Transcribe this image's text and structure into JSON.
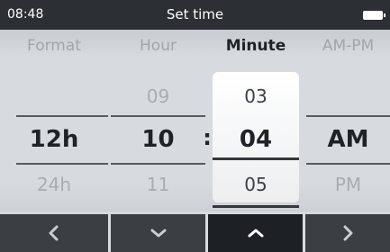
{
  "status": {
    "time": "08:48",
    "title": "Set time",
    "battery_icon": "battery-icon"
  },
  "columns": {
    "format": {
      "header": "Format",
      "prev": "",
      "selected": "12h",
      "next": "24h"
    },
    "hour": {
      "header": "Hour",
      "prev": "09",
      "selected": "10",
      "next": "11"
    },
    "minute": {
      "header": "Minute",
      "prev": "03",
      "selected": "04",
      "next": "05"
    },
    "ampm": {
      "header": "AM-PM",
      "prev": "",
      "selected": "AM",
      "next": "PM"
    }
  },
  "active_column": "minute",
  "separator": ":",
  "nav": {
    "buttons": [
      {
        "icon": "chevron-left-icon"
      },
      {
        "icon": "chevron-down-icon"
      },
      {
        "icon": "chevron-up-icon",
        "active": true
      },
      {
        "icon": "chevron-right-icon"
      }
    ]
  },
  "colors": {
    "statusbar": "#2c2f33",
    "background": "#d7dbdf",
    "nav_button": "#3b3f44",
    "nav_button_active": "#1d2024",
    "active_text": "#1f2226",
    "dim_text": "#a9adb2"
  }
}
